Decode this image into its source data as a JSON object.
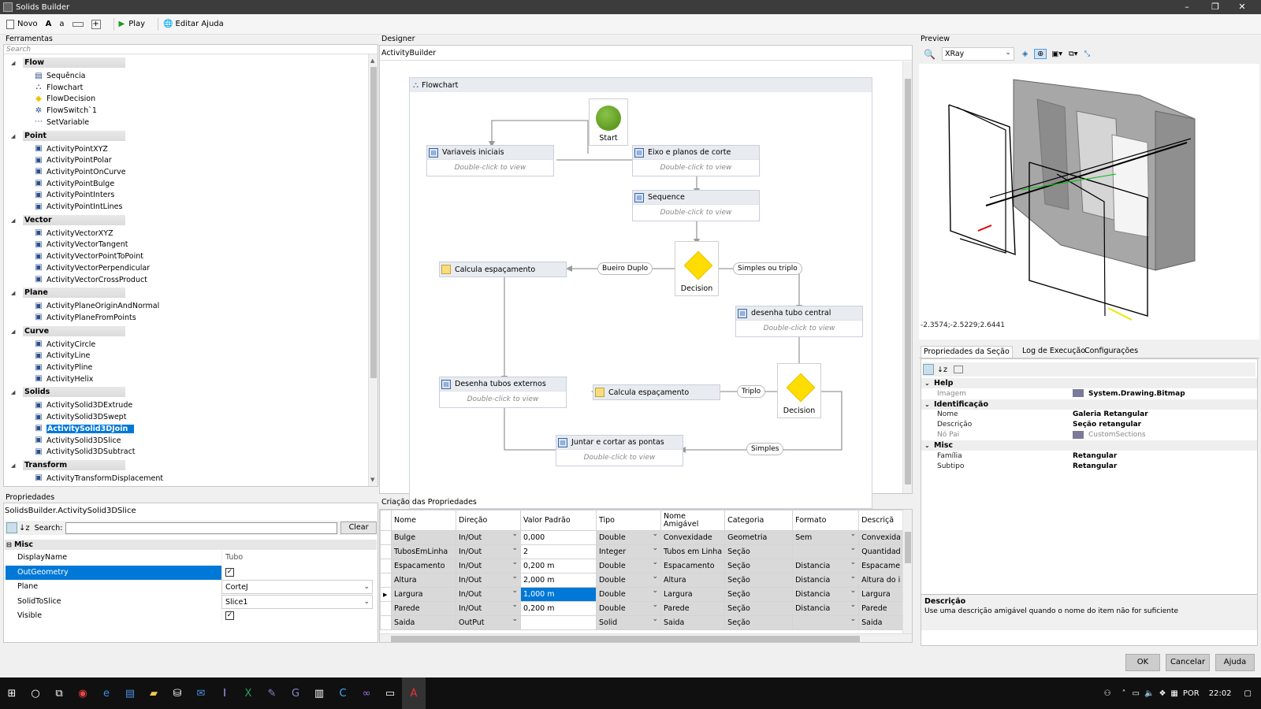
{
  "window": {
    "title": "Solids Builder",
    "minimize": "–",
    "restore": "❐",
    "close": "✕"
  },
  "toolbar": {
    "new": "Novo",
    "font_big": "A",
    "font_small": "a",
    "play": "Play",
    "edit_help": "Editar Ajuda"
  },
  "tools": {
    "title": "Ferramentas",
    "search_placeholder": "Search",
    "categories": [
      {
        "name": "Flow",
        "items": [
          "Sequência",
          "Flowchart",
          "FlowDecision",
          "FlowSwitch`1",
          "SetVariable"
        ]
      },
      {
        "name": "Point",
        "items": [
          "ActivityPointXYZ",
          "ActivityPointPolar",
          "ActivityPointOnCurve",
          "ActivityPointBulge",
          "ActivityPointInters",
          "ActivityPointIntLines"
        ]
      },
      {
        "name": "Vector",
        "items": [
          "ActivityVectorXYZ",
          "ActivityVectorTangent",
          "ActivityVectorPointToPoint",
          "ActivityVectorPerpendicular",
          "ActivityVectorCrossProduct"
        ]
      },
      {
        "name": "Plane",
        "items": [
          "ActivityPlaneOriginAndNormal",
          "ActivityPlaneFromPoints"
        ]
      },
      {
        "name": "Curve",
        "items": [
          "ActivityCircle",
          "ActivityLine",
          "ActivityPline",
          "ActivityHelix"
        ]
      },
      {
        "name": "Solids",
        "items": [
          "ActivitySolid3DExtrude",
          "ActivitySolid3DSwept",
          "ActivitySolid3DJoin",
          "ActivitySolid3DSlice",
          "ActivitySolid3DSubtract"
        ]
      },
      {
        "name": "Transform",
        "items": [
          "ActivityTransformDisplacement",
          "ActivityTransformRotate"
        ]
      }
    ],
    "selected": "ActivitySolid3DJoin"
  },
  "props": {
    "title": "Propriedades",
    "object": "SolidsBuilder.ActivitySolid3DSlice",
    "search_label": "Search:",
    "clear": "Clear",
    "section": "Misc",
    "rows": [
      {
        "k": "DisplayName",
        "v": "Tubo"
      },
      {
        "k": "OutGeometry",
        "v": "✓"
      },
      {
        "k": "Plane",
        "v": "CorteJ"
      },
      {
        "k": "SolidToSlice",
        "v": "Slice1"
      },
      {
        "k": "Visible",
        "v": "✓"
      }
    ]
  },
  "designer": {
    "title": "Designer",
    "breadcrumb": "ActivityBuilder",
    "flowchart": "Flowchart",
    "start": "Start",
    "dbl": "Double-click to view",
    "acts": {
      "vars": "Variaveis iniciais",
      "eixo": "Eixo e planos de corte",
      "seq": "Sequence",
      "calc1": "Calcula espaçamento",
      "tubo": "desenha tubo central",
      "ext": "Desenha tubos externos",
      "calc2": "Calcula espaçamento",
      "juntar": "Juntar e cortar as pontas"
    },
    "decision": "Decision",
    "labels": {
      "duplo": "Bueiro Duplo",
      "simples_triplo": "Simples ou triplo",
      "triplo": "Triplo",
      "simples": "Simples"
    }
  },
  "creation": {
    "title": "Criação das Propriedades",
    "headers": [
      "Nome",
      "Direção",
      "Valor Padrão",
      "Tipo",
      "Nome Amigável",
      "Categoria",
      "Formato",
      "Descriçã"
    ],
    "rows": [
      [
        "Bulge",
        "In/Out",
        "0,000",
        "Double",
        "Convexidade",
        "Geometria",
        "Sem",
        "Convexida"
      ],
      [
        "TubosEmLinha",
        "In/Out",
        "2",
        "Integer",
        "Tubos em Linha",
        "Seção",
        "",
        "Quantidad"
      ],
      [
        "Espacamento",
        "In/Out",
        "0,200 m",
        "Double",
        "Espacamento",
        "Seção",
        "Distancia",
        "Espacame"
      ],
      [
        "Altura",
        "In/Out",
        "2,000 m",
        "Double",
        "Altura",
        "Seção",
        "Distancia",
        "Altura do i"
      ],
      [
        "Largura",
        "In/Out",
        "1,000 m",
        "Double",
        "Largura",
        "Seção",
        "Distancia",
        "Largura"
      ],
      [
        "Parede",
        "In/Out",
        "0,200 m",
        "Double",
        "Parede",
        "Seção",
        "Distancia",
        "Parede"
      ],
      [
        "Saida",
        "OutPut",
        "",
        "Solid",
        "Saida",
        "Seção",
        "",
        "Saida"
      ]
    ]
  },
  "preview": {
    "title": "Preview",
    "mode": "XRay",
    "coords": "-2.3574;-2.5229;2.6441"
  },
  "section": {
    "tabs": [
      "Propriedades da Seção",
      "Log de Execução",
      "Configurações"
    ],
    "groups": [
      {
        "name": "Help",
        "rows": [
          {
            "k": "Imagem",
            "v": "System.Drawing.Bitmap"
          }
        ]
      },
      {
        "name": "Identificação",
        "rows": [
          {
            "k": "Nome",
            "v": "Galeria Retangular"
          },
          {
            "k": "Descrição",
            "v": "Seção retangular"
          },
          {
            "k": "Nó Pai",
            "v": "CustomSections"
          }
        ]
      },
      {
        "name": "Misc",
        "rows": [
          {
            "k": "Família",
            "v": "Retangular"
          },
          {
            "k": "Subtipo",
            "v": "Retangular"
          }
        ]
      }
    ],
    "desc_title": "Descrição",
    "desc_text": "Use uma descrição amigável quando o nome do item não for suficiente"
  },
  "buttons": {
    "ok": "OK",
    "cancel": "Cancelar",
    "help": "Ajuda"
  },
  "taskbar": {
    "lang": "POR",
    "time": "22:02"
  }
}
